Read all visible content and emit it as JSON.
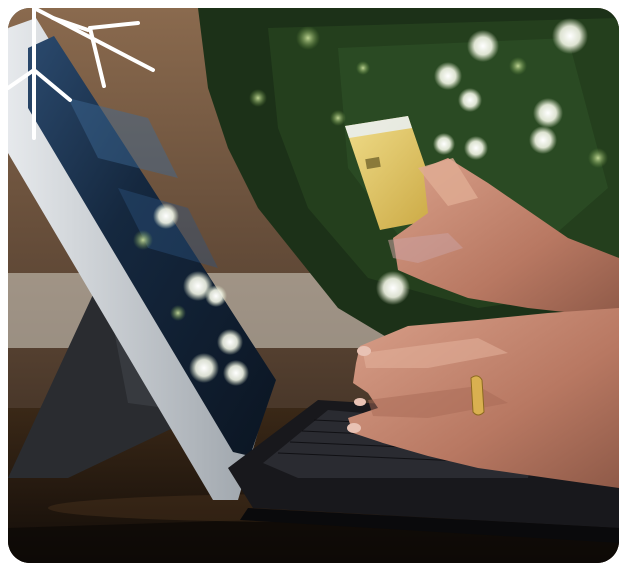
{
  "image": {
    "subject": "photo",
    "overlay_icon": "snowflake-icon",
    "colors": {
      "background_tree": "#1f3a1c",
      "bokeh_light": "#f2f5e6",
      "table_wood": "#2a1c12",
      "card_gold": "#e0c35a",
      "skin": "#c98a73",
      "tablet_body": "#c8cdd2",
      "keyboard": "#1a1a1e",
      "snowflake": "#ffffff"
    }
  }
}
